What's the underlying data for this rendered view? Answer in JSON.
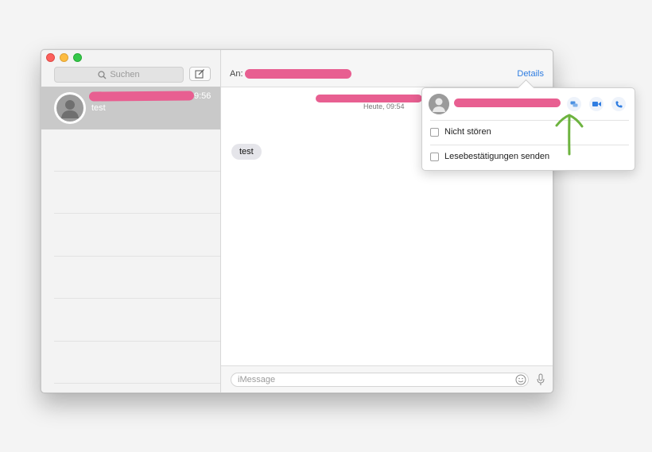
{
  "sidebar": {
    "search_placeholder": "Suchen",
    "conversations": [
      {
        "time": "9:56",
        "preview": "test"
      }
    ]
  },
  "header": {
    "to_label": "An:",
    "details_label": "Details"
  },
  "messages": {
    "timestamp": "Heute, 09:54",
    "bubbles": [
      {
        "text": "test"
      }
    ]
  },
  "composer": {
    "placeholder": "iMessage"
  },
  "details_popover": {
    "options": [
      {
        "label": "Nicht stören",
        "checked": false
      },
      {
        "label": "Lesebestätigungen senden",
        "checked": false
      }
    ]
  },
  "colors": {
    "accent": "#2f7de1",
    "redaction": "#e85f91",
    "annotation_arrow": "#6db33f",
    "selected_row": "#c9c9c9"
  },
  "icons": [
    "search-icon",
    "compose-icon",
    "person-icon",
    "message-icon",
    "video-icon",
    "phone-icon",
    "emoji-icon",
    "microphone-icon"
  ]
}
